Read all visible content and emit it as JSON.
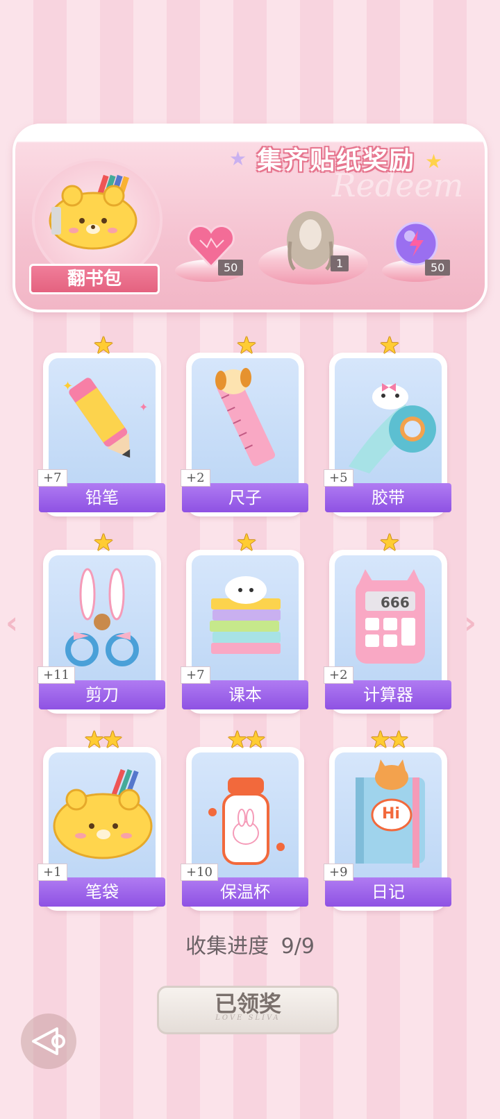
{
  "banner": {
    "title": "集齐贴纸奖励",
    "watermark": "Redeem",
    "reward_pack": {
      "label": "翻书包",
      "icon": "pencil-pouch-icon"
    },
    "rewards": [
      {
        "icon": "pink-heart-gem-icon",
        "count": "50"
      },
      {
        "icon": "hairstyle-icon",
        "count": "1"
      },
      {
        "icon": "purple-energy-orb-icon",
        "count": "50"
      }
    ]
  },
  "stickers": [
    {
      "name": "铅笔",
      "count": "+7",
      "stars": "★",
      "icon": "pencil-icon"
    },
    {
      "name": "尺子",
      "count": "+2",
      "stars": "★",
      "icon": "ruler-icon"
    },
    {
      "name": "胶带",
      "count": "+5",
      "stars": "★",
      "icon": "tape-icon"
    },
    {
      "name": "剪刀",
      "count": "+11",
      "stars": "★",
      "icon": "scissors-icon"
    },
    {
      "name": "课本",
      "count": "+7",
      "stars": "★",
      "icon": "textbooks-icon"
    },
    {
      "name": "计算器",
      "count": "+2",
      "stars": "★",
      "icon": "calculator-icon"
    },
    {
      "name": "笔袋",
      "count": "+1",
      "stars": "★★",
      "icon": "pencil-case-icon"
    },
    {
      "name": "保温杯",
      "count": "+10",
      "stars": "★★",
      "icon": "thermos-icon"
    },
    {
      "name": "日记",
      "count": "+9",
      "stars": "★★",
      "icon": "diary-icon"
    }
  ],
  "calculator_display": "666",
  "diary_text": "Hi",
  "progress": {
    "label": "收集进度",
    "value": "9/9"
  },
  "claim_button": {
    "label": "已领奖",
    "sub": "LOVE SLIVA"
  },
  "nav": {
    "left": "‹",
    "right": "›"
  },
  "colors": {
    "accent_purple": "#9a62ea",
    "banner_pink": "#f2b6c6",
    "star_gold": "#ffcc33"
  }
}
